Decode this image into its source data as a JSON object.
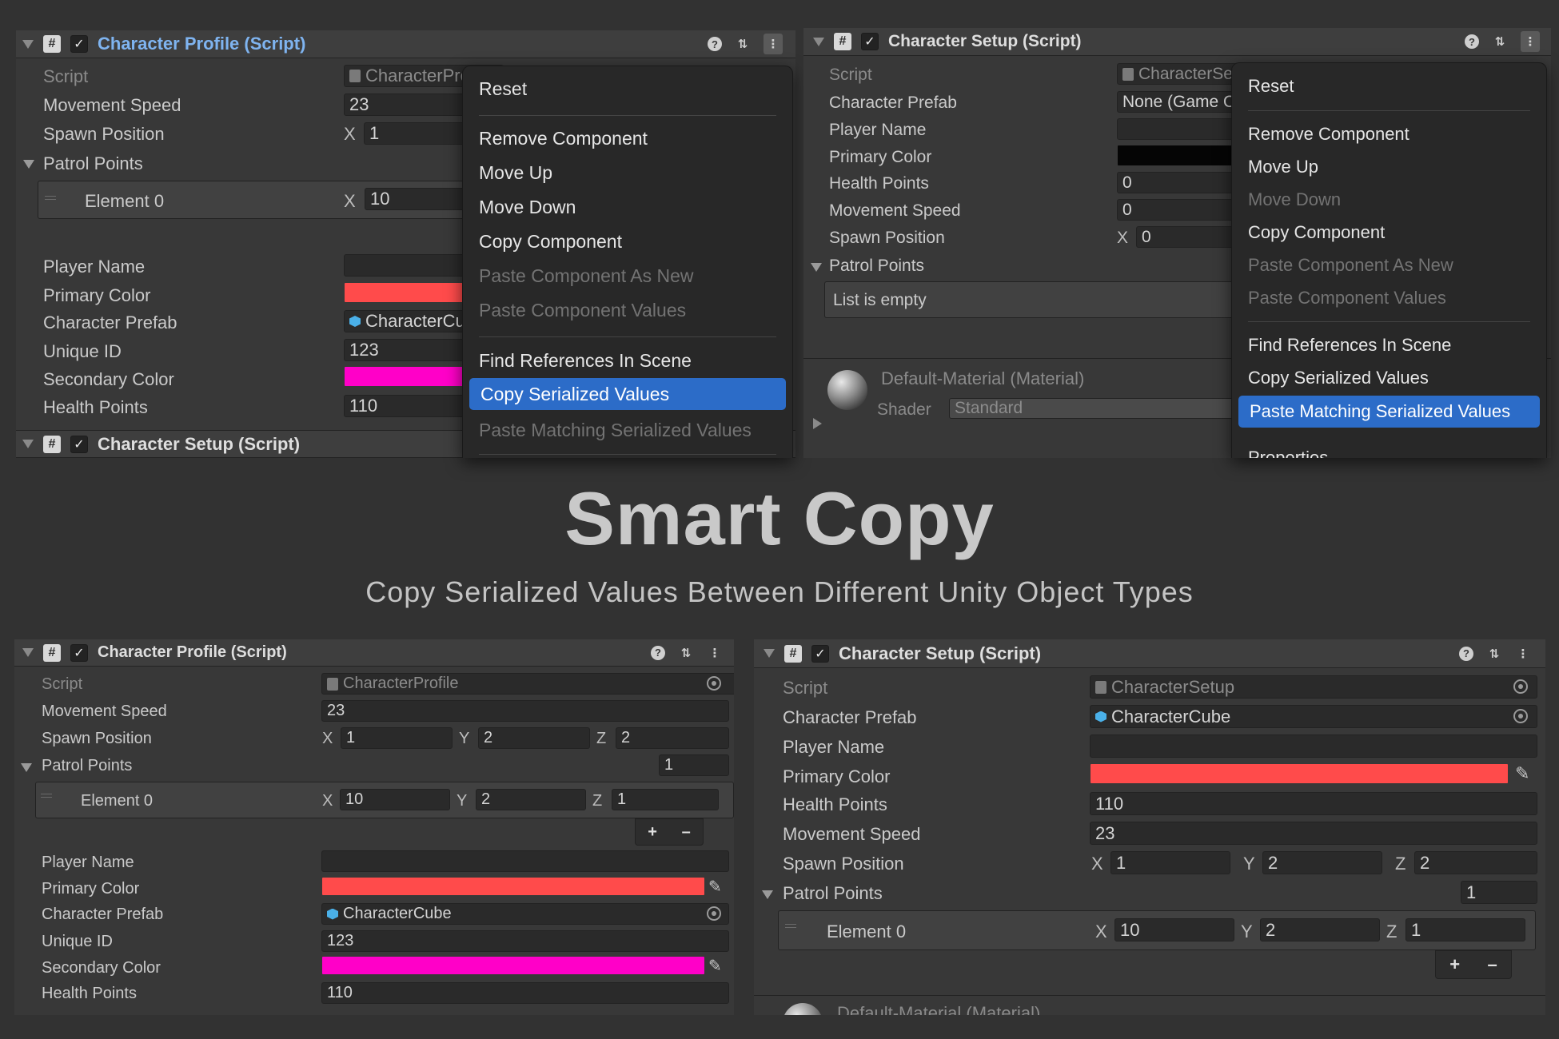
{
  "title": "Smart Copy",
  "subtitle": "Copy Serialized Values Between Different Unity Object Types",
  "top_left": {
    "header": "Character Profile (Script)",
    "fields": {
      "script": "Script",
      "script_value": "CharacterProfile",
      "movement_speed": "Movement Speed",
      "movement_speed_value": "23",
      "spawn_position": "Spawn Position",
      "spawn_x": "1",
      "patrol_points": "Patrol Points",
      "element0": "Element 0",
      "element0_x": "10",
      "player_name": "Player Name",
      "primary_color": "Primary Color",
      "character_prefab": "Character Prefab",
      "character_prefab_value": "CharacterCube",
      "unique_id": "Unique ID",
      "unique_id_value": "123",
      "secondary_color": "Secondary Color",
      "health_points": "Health Points",
      "health_points_value": "110"
    },
    "next_header": "Character Setup (Script)",
    "menu": {
      "reset": "Reset",
      "remove": "Remove Component",
      "move_up": "Move Up",
      "move_down": "Move Down",
      "copy_component": "Copy Component",
      "paste_new": "Paste Component As New",
      "paste_values": "Paste Component Values",
      "find_refs": "Find References In Scene",
      "copy_serialized": "Copy Serialized Values",
      "paste_matching": "Paste Matching Serialized Values"
    }
  },
  "top_right": {
    "header": "Character Setup (Script)",
    "fields": {
      "script": "Script",
      "script_value": "CharacterSetup",
      "character_prefab": "Character Prefab",
      "character_prefab_value": "None (Game Object)",
      "player_name": "Player Name",
      "primary_color": "Primary Color",
      "health_points": "Health Points",
      "health_points_value": "0",
      "movement_speed": "Movement Speed",
      "movement_speed_value": "0",
      "spawn_position": "Spawn Position",
      "spawn_x": "0",
      "patrol_points": "Patrol Points",
      "list_empty": "List is empty"
    },
    "material": {
      "name": "Default-Material (Material)",
      "shader_label": "Shader",
      "shader_value": "Standard"
    },
    "menu": {
      "reset": "Reset",
      "remove": "Remove Component",
      "move_up": "Move Up",
      "move_down": "Move Down",
      "copy_component": "Copy Component",
      "paste_new": "Paste Component As New",
      "paste_values": "Paste Component Values",
      "find_refs": "Find References In Scene",
      "copy_serialized": "Copy Serialized Values",
      "paste_matching": "Paste Matching Serialized Values",
      "properties": "Properties..."
    }
  },
  "bottom_left": {
    "header": "Character Profile (Script)",
    "fields": {
      "script": "Script",
      "script_value": "CharacterProfile",
      "movement_speed": "Movement Speed",
      "movement_speed_value": "23",
      "spawn_position": "Spawn Position",
      "spawn_x": "1",
      "spawn_y": "2",
      "spawn_z": "2",
      "patrol_points": "Patrol Points",
      "patrol_count": "1",
      "element0": "Element 0",
      "element0_x": "10",
      "element0_y": "2",
      "element0_z": "1",
      "player_name": "Player Name",
      "primary_color": "Primary Color",
      "character_prefab": "Character Prefab",
      "character_prefab_value": "CharacterCube",
      "unique_id": "Unique ID",
      "unique_id_value": "123",
      "secondary_color": "Secondary Color",
      "health_points": "Health Points",
      "health_points_value": "110"
    }
  },
  "bottom_right": {
    "header": "Character Setup (Script)",
    "fields": {
      "script": "Script",
      "script_value": "CharacterSetup",
      "character_prefab": "Character Prefab",
      "character_prefab_value": "CharacterCube",
      "player_name": "Player Name",
      "primary_color": "Primary Color",
      "health_points": "Health Points",
      "health_points_value": "110",
      "movement_speed": "Movement Speed",
      "movement_speed_value": "23",
      "spawn_position": "Spawn Position",
      "spawn_x": "1",
      "spawn_y": "2",
      "spawn_z": "2",
      "patrol_points": "Patrol Points",
      "patrol_count": "1",
      "element0": "Element 0",
      "element0_x": "10",
      "element0_y": "2",
      "element0_z": "1"
    },
    "material_name": "Default-Material (Material)"
  },
  "axes": {
    "x": "X",
    "y": "Y",
    "z": "Z"
  },
  "buttons": {
    "plus": "+",
    "minus": "–"
  },
  "icons": {
    "hash": "#",
    "check": "✓",
    "help": "?",
    "presets": "⇅",
    "more": "⋮"
  },
  "colors": {
    "primary": "#ff4b4b",
    "secondary": "#ff00c8",
    "black": "#050505",
    "accent": "#2c6cc8",
    "header_link": "#7fb4f0"
  }
}
